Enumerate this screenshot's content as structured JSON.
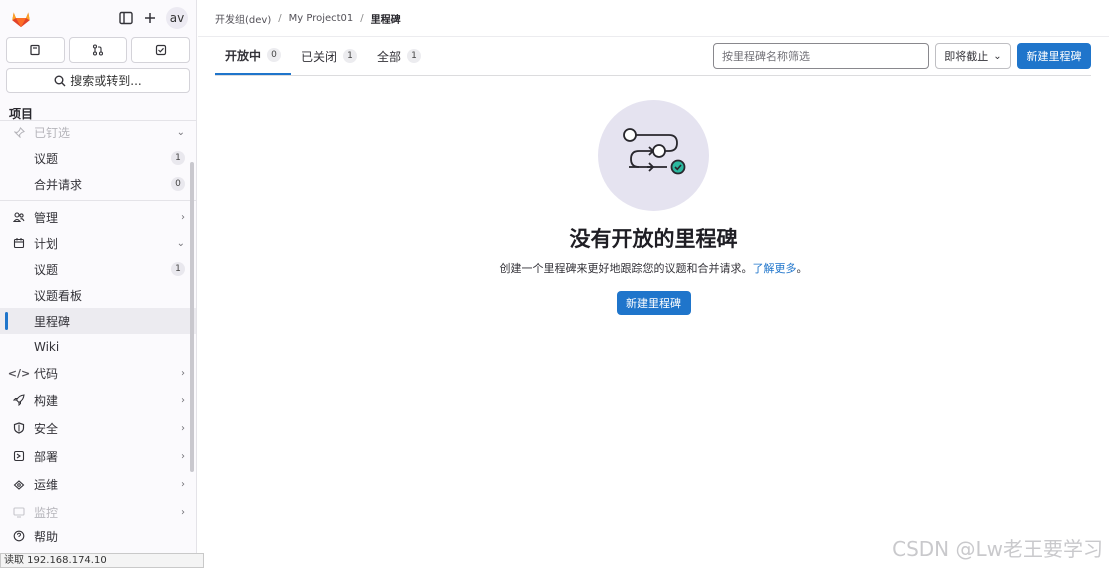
{
  "sidebar": {
    "avatar_text": "av",
    "search_label": "搜索或转到...",
    "section_label": "项目",
    "pinned": {
      "label": "已钉选",
      "items": [
        {
          "label": "议题",
          "count": "1"
        },
        {
          "label": "合并请求",
          "count": "0"
        }
      ]
    },
    "manage_label": "管理",
    "plan": {
      "label": "计划",
      "items": [
        {
          "label": "议题",
          "count": "1"
        },
        {
          "label": "议题看板"
        },
        {
          "label": "里程碑"
        },
        {
          "label": "Wiki"
        }
      ]
    },
    "code_label": "代码",
    "build_label": "构建",
    "security_label": "安全",
    "deploy_label": "部署",
    "operate_label": "运维",
    "monitor_label": "监控",
    "help_label": "帮助"
  },
  "status_bar": "读取 192.168.174.10",
  "breadcrumb": {
    "group": "开发组(dev)",
    "project": "My Project01",
    "current": "里程碑"
  },
  "tabs": [
    {
      "label": "开放中",
      "count": "0"
    },
    {
      "label": "已关闭",
      "count": "1"
    },
    {
      "label": "全部",
      "count": "1"
    }
  ],
  "filter": {
    "placeholder": "按里程碑名称筛选"
  },
  "sort": {
    "label": "即将截止"
  },
  "new_milestone_button": "新建里程碑",
  "empty_state": {
    "title": "没有开放的里程碑",
    "description": "创建一个里程碑来更好地跟踪您的议题和合并请求。",
    "learn_more": "了解更多",
    "end_punct": "。",
    "button": "新建里程碑"
  },
  "watermark": "CSDN @Lw老王要学习",
  "colors": {
    "accent": "#1f75cb",
    "illustration_bg": "#e5e3f0",
    "check": "#2bb9a0"
  }
}
